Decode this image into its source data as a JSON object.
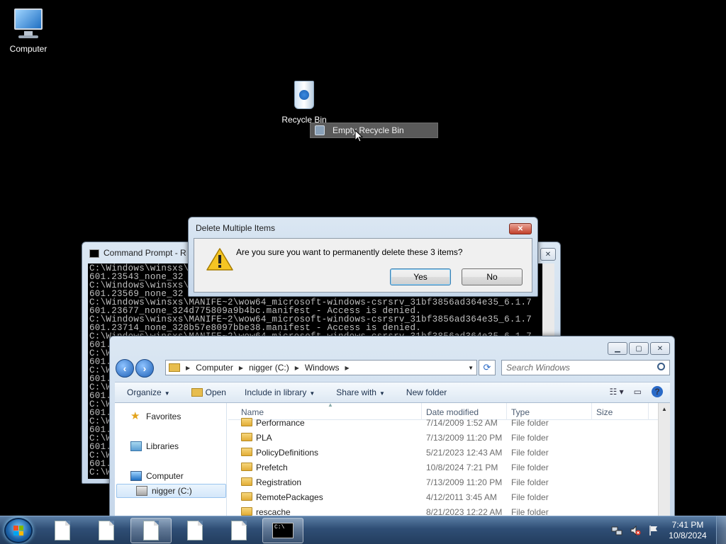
{
  "desktop": {
    "icons": [
      {
        "label": "Computer"
      },
      {
        "label": "Recycle Bin"
      }
    ],
    "context_menu_item": "Empty Recycle Bin"
  },
  "cmd": {
    "title": "Command Prompt - R",
    "lines": [
      "C:\\Windows\\winsxs\\MANIFE~2\\wow64_microsoft-windows-csrsrv_31bf3856ad364e35_6.1.7",
      "601.23543_none_32",
      "C:\\Windows\\winsxs\\MANIFE~2\\wow64_microsoft-windows-csrsrv_31bf3856ad364e35_6.1.7",
      "601.23569_none_32",
      "C:\\Windows\\winsxs\\MANIFE~2\\wow64_microsoft-windows-csrsrv_31bf3856ad364e35_6.1.7",
      "601.23677_none_324d775809a9b4bc.manifest - Access is denied.",
      "C:\\Windows\\winsxs\\MANIFE~2\\wow64_microsoft-windows-csrsrv_31bf3856ad364e35_6.1.7",
      "601.23714_none_328b57e8097bbe38.manifest - Access is denied.",
      "C:\\Windows\\winsxs\\MANIFE~2\\wow64_microsoft-windows-csrsrv_31bf3856ad364e35_6.1.7",
      "601.",
      "C:\\W",
      "601.",
      "C:\\W",
      "601.",
      "C:\\W",
      "601.",
      "C:\\W",
      "601.",
      "C:\\W",
      "601.",
      "C:\\W",
      "601.",
      "C:\\W",
      "601.",
      "C:\\W"
    ]
  },
  "dialog": {
    "title": "Delete Multiple Items",
    "message": "Are you sure you want to permanently delete these 3 items?",
    "yes": "Yes",
    "no": "No"
  },
  "explorer": {
    "breadcrumb": [
      "Computer",
      "nigger (C:)",
      "Windows"
    ],
    "search_placeholder": "Search Windows",
    "toolbar": {
      "organize": "Organize",
      "open": "Open",
      "include": "Include in library",
      "share": "Share with",
      "new_folder": "New folder"
    },
    "nav": {
      "favorites": "Favorites",
      "libraries": "Libraries",
      "computer": "Computer",
      "drive": "nigger (C:)"
    },
    "columns": {
      "name": "Name",
      "date": "Date modified",
      "type": "Type",
      "size": "Size"
    },
    "rows": [
      {
        "name": "Performance",
        "date": "7/14/2009 1:52 AM",
        "type": "File folder"
      },
      {
        "name": "PLA",
        "date": "7/13/2009 11:20 PM",
        "type": "File folder"
      },
      {
        "name": "PolicyDefinitions",
        "date": "5/21/2023 12:43 AM",
        "type": "File folder"
      },
      {
        "name": "Prefetch",
        "date": "10/8/2024 7:21 PM",
        "type": "File folder"
      },
      {
        "name": "Registration",
        "date": "7/13/2009 11:20 PM",
        "type": "File folder"
      },
      {
        "name": "RemotePackages",
        "date": "4/12/2011 3:45 AM",
        "type": "File folder"
      },
      {
        "name": "rescache",
        "date": "8/21/2023 12:22 AM",
        "type": "File folder"
      }
    ]
  },
  "taskbar": {
    "time": "7:41 PM",
    "date": "10/8/2024"
  },
  "colors": {
    "desktop_bg": "#000000",
    "taskbar": "#2f4e75",
    "dialog_bg": "#f0f0f0",
    "cmd_text": "#c0c0c0"
  }
}
